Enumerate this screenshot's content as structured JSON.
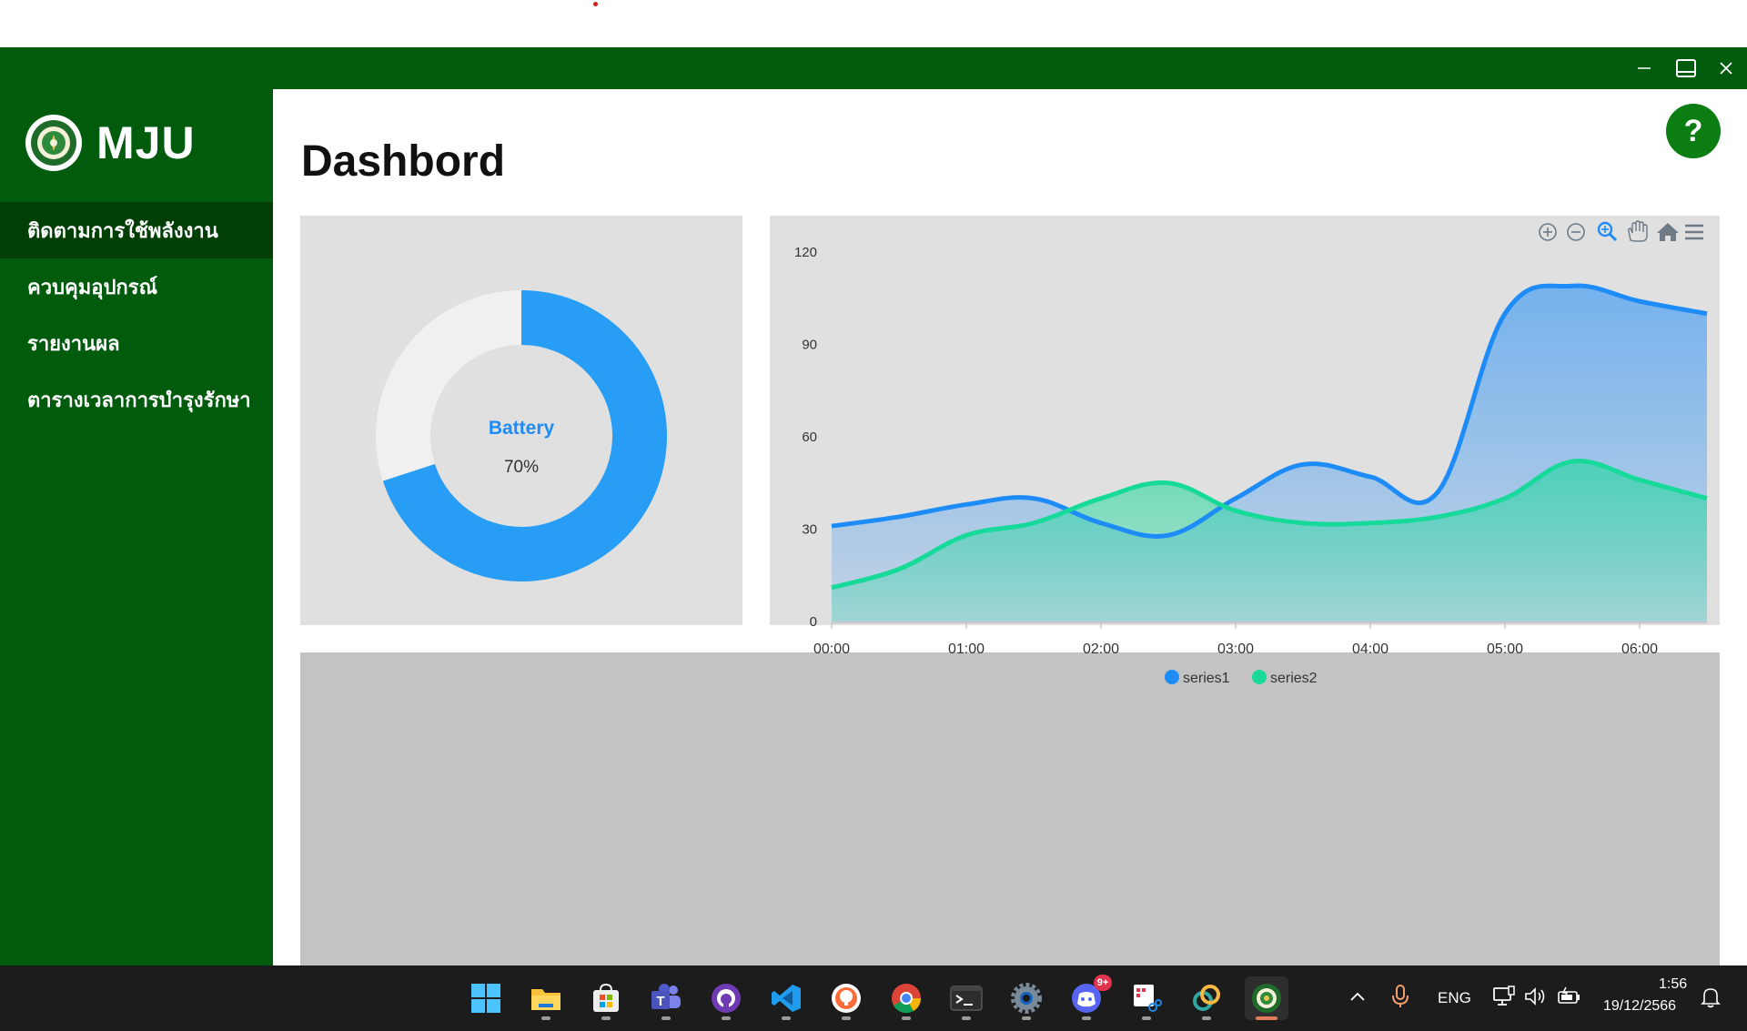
{
  "window": {
    "controls": [
      "minimize-icon",
      "maximize-icon",
      "close-icon"
    ]
  },
  "sidebar": {
    "brand": "MJU",
    "items": [
      {
        "label": "ติดตามการใช้พลังงาน",
        "active": true
      },
      {
        "label": "ควบคุมอุปกรณ์",
        "active": false
      },
      {
        "label": "รายงานผล",
        "active": false
      },
      {
        "label": "ตารางเวลาการบำรุงรักษา",
        "active": false
      }
    ]
  },
  "main": {
    "title": "Dashbord",
    "help": "?"
  },
  "colors": {
    "brand_green": "#005c0c",
    "active_nav": "#013f07",
    "series1": "#1d8cf8",
    "series2": "#17d99a",
    "donut_fill": "#279df5",
    "donut_track": "#f0f0f0"
  },
  "chart_data": [
    {
      "type": "pie",
      "style": "donut",
      "label": "Battery",
      "value_text": "70%",
      "values": [
        70,
        30
      ]
    },
    {
      "type": "area",
      "x": [
        "00:00",
        "01:00",
        "02:00",
        "03:00",
        "04:00",
        "05:00",
        "06:00"
      ],
      "ylim": [
        0,
        120
      ],
      "yticks": [
        0,
        30,
        60,
        90,
        120
      ],
      "x_points": [
        0,
        0.5,
        1,
        1.5,
        2,
        2.5,
        3,
        3.5,
        4,
        4.5,
        5,
        5.5,
        6,
        6.5
      ],
      "series": [
        {
          "name": "series1",
          "values": [
            31,
            34,
            38,
            40,
            32,
            28,
            40,
            51,
            47,
            42,
            100,
            109,
            104,
            100
          ]
        },
        {
          "name": "series2",
          "values": [
            11,
            17,
            28,
            32,
            40,
            45,
            36,
            32,
            32,
            34,
            40,
            52,
            46,
            40
          ]
        }
      ],
      "legend": "bottom-center",
      "toolbar": [
        "zoom-in-icon",
        "zoom-out-icon",
        "zoom-select-icon",
        "pan-hand-icon",
        "home-icon",
        "menu-icon"
      ]
    }
  ],
  "taskbar": {
    "apps": [
      {
        "name": "windows-start-icon"
      },
      {
        "name": "file-explorer-icon"
      },
      {
        "name": "microsoft-store-icon"
      },
      {
        "name": "teams-icon"
      },
      {
        "name": "github-desktop-icon"
      },
      {
        "name": "vscode-icon"
      },
      {
        "name": "postman-icon"
      },
      {
        "name": "chrome-icon"
      },
      {
        "name": "terminal-icon"
      },
      {
        "name": "settings-icon"
      },
      {
        "name": "discord-icon",
        "badge": "9+"
      },
      {
        "name": "snipping-tool-icon"
      },
      {
        "name": "linked-app-icon"
      },
      {
        "name": "mju-app-icon",
        "active": true
      }
    ],
    "tray": {
      "language": "ENG",
      "time": "1:56",
      "date": "19/12/2566"
    }
  }
}
